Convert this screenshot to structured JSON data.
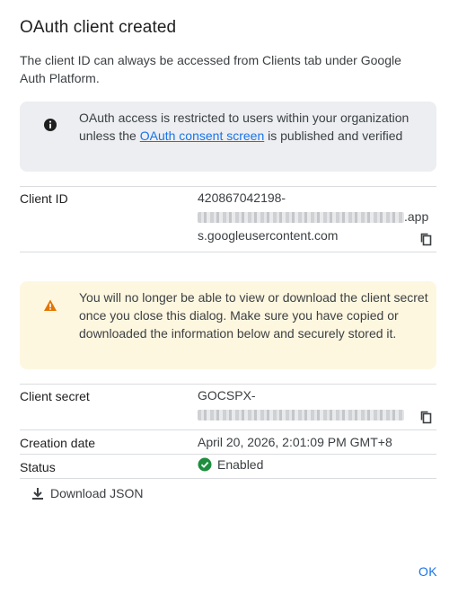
{
  "dialog": {
    "title": "OAuth client created",
    "intro": "The client ID can always be accessed from Clients tab under Google Auth Platform."
  },
  "info_banner": {
    "icon": "info-icon",
    "text_before": "OAuth access is restricted to users within your organization unless the ",
    "link": "OAuth consent screen",
    "text_after": " is published and verified"
  },
  "client_id": {
    "label": "Client ID",
    "line1": "420867042198-",
    "line2_suffix": ".app",
    "line3": "s.googleusercontent.com",
    "copy_icon": "copy-icon"
  },
  "warning_banner": {
    "icon": "warning-icon",
    "text": "You will no longer be able to view or download the client secret once you close this dialog. Make sure you have copied or downloaded the information below and securely stored it."
  },
  "client_secret": {
    "label": "Client secret",
    "line1": "GOCSPX-",
    "copy_icon": "copy-icon"
  },
  "creation_date": {
    "label": "Creation date",
    "value": "April 20, 2026, 2:01:09 PM GMT+8"
  },
  "status": {
    "label": "Status",
    "value": "Enabled",
    "icon": "check-circle-icon"
  },
  "download": {
    "label": "Download JSON",
    "icon": "download-icon"
  },
  "actions": {
    "ok_label": "OK"
  },
  "colors": {
    "accent": "#1a73e8",
    "success": "#1e8e3e",
    "warning": "#e37400",
    "info_bg": "#eceef1",
    "warning_bg": "#fef7e0"
  }
}
